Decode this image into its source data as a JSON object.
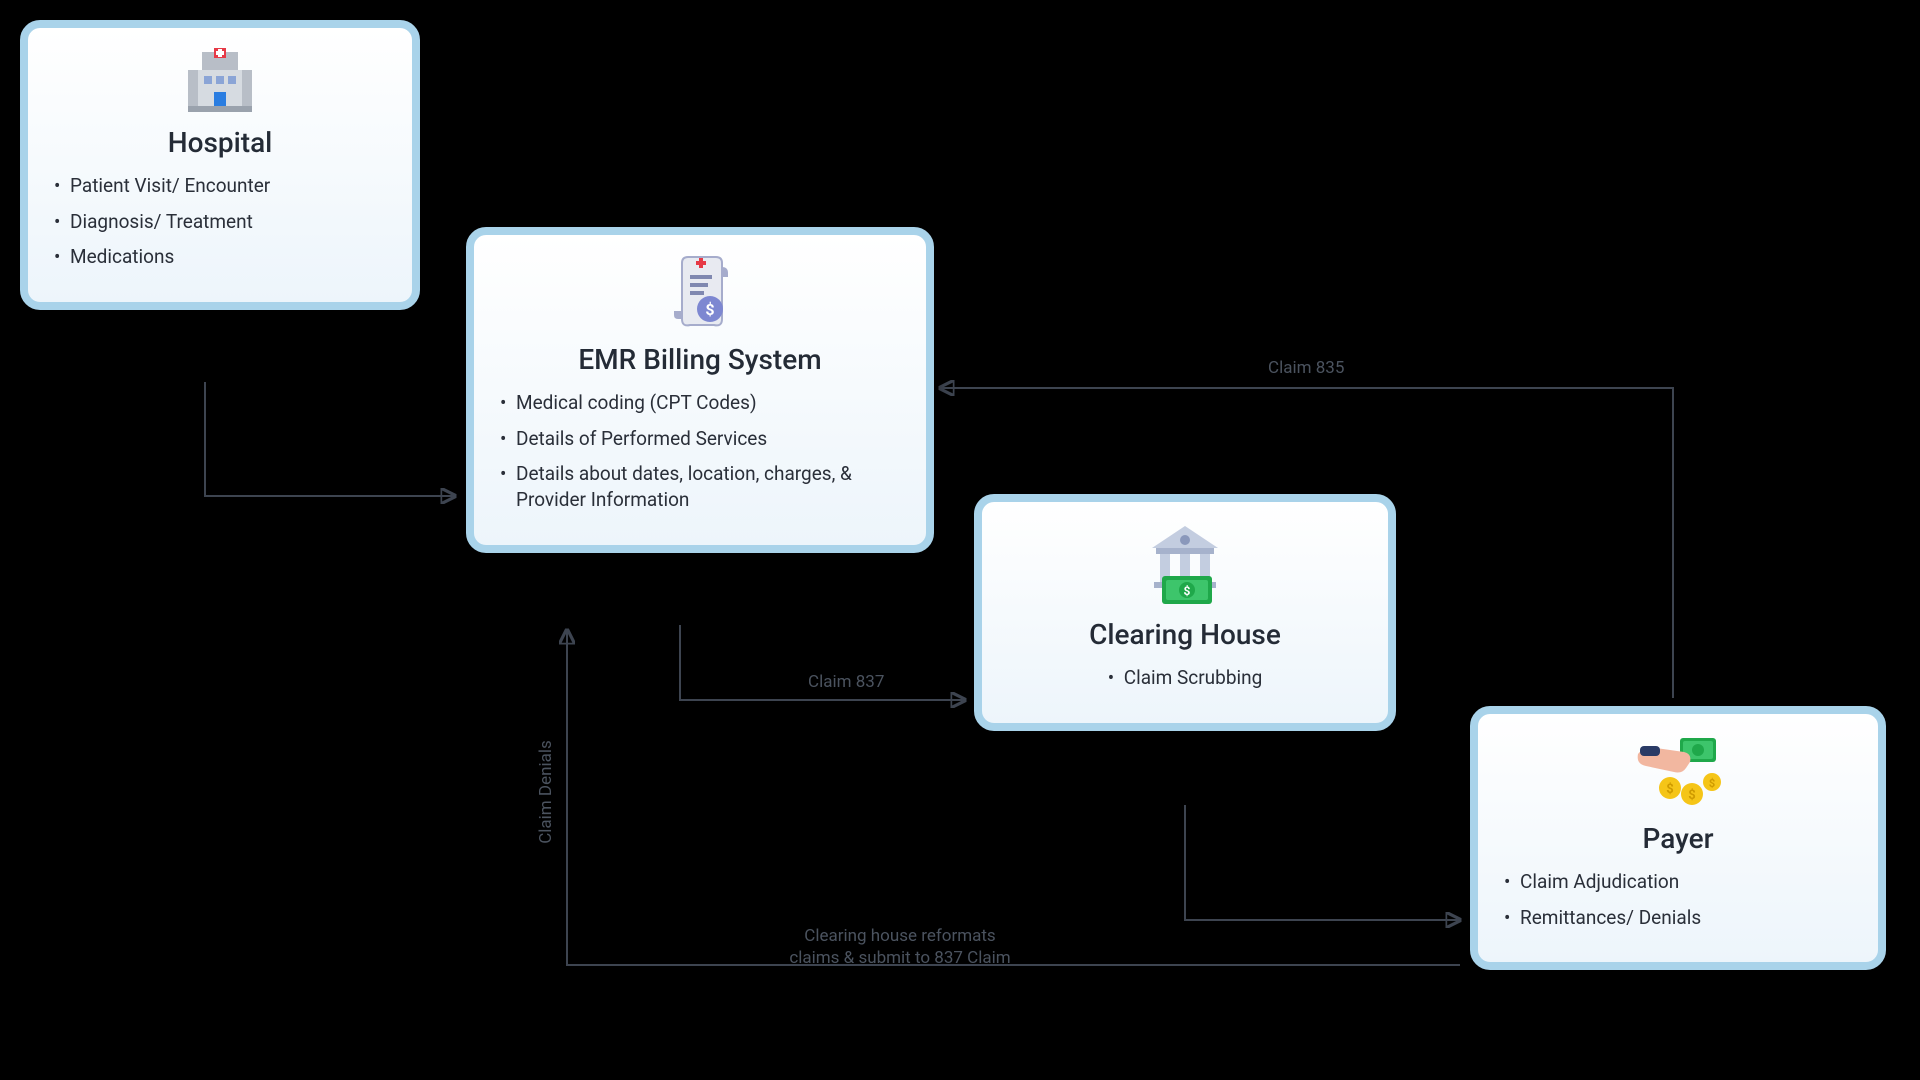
{
  "nodes": {
    "hospital": {
      "title": "Hospital",
      "items": [
        "Patient Visit/ Encounter",
        "Diagnosis/ Treatment",
        "Medications"
      ]
    },
    "emr": {
      "title": "EMR Billing System",
      "items": [
        "Medical coding (CPT Codes)",
        "Details of Performed Services",
        "Details about dates, location, charges, & Provider Information"
      ]
    },
    "clearing": {
      "title": "Clearing House",
      "items": [
        "Claim Scrubbing"
      ]
    },
    "payer": {
      "title": "Payer",
      "items": [
        "Claim Adjudication",
        "Remittances/ Denials"
      ]
    }
  },
  "edges": {
    "claim837": "Claim 837",
    "claim835": "Claim 835",
    "claimDenials": "Claim Denials",
    "reformat1": "Clearing house reformats",
    "reformat2": "claims & submit to 837 Claim"
  }
}
